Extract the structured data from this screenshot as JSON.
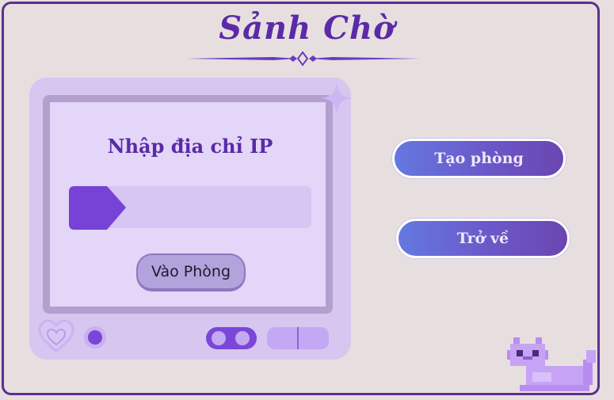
{
  "header": {
    "title": "Sảnh Chờ"
  },
  "join_panel": {
    "label": "Nhập địa chỉ IP",
    "ip_input": {
      "value": "",
      "placeholder": ""
    },
    "enter_button_label": "Vào Phòng"
  },
  "actions": {
    "create_room_label": "Tạo phòng",
    "back_label": "Trở về"
  },
  "icons": {
    "title_ornament": "ornament-divider-icon",
    "sparkle": "sparkle-icon",
    "heart": "heart-icon",
    "cat": "pixel-cat-icon"
  },
  "colors": {
    "frame": "#5d2f8f",
    "title": "#5b2aa8",
    "device": "#d7c6f0",
    "accent": "#7a45d8",
    "button_gradient_start": "#6578e0",
    "button_gradient_end": "#6b46b0"
  }
}
